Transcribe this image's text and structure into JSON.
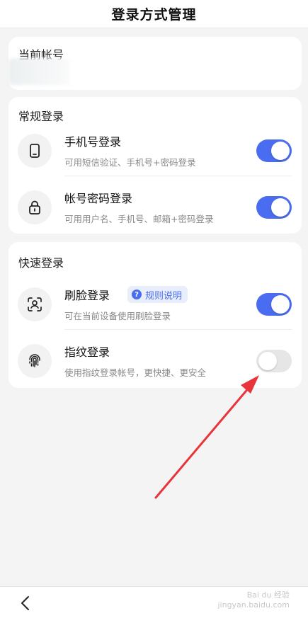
{
  "header": {
    "title": "登录方式管理"
  },
  "account_card": {
    "title": "当前帐号"
  },
  "regular_login": {
    "title": "常规登录",
    "items": [
      {
        "label": "手机号登录",
        "sub": "可用短信验证、手机号+密码登录",
        "icon": "phone-icon",
        "enabled": true
      },
      {
        "label": "帐号密码登录",
        "sub": "可用用户名、手机号、邮箱+密码登录",
        "icon": "lock-icon",
        "enabled": true
      }
    ]
  },
  "quick_login": {
    "title": "快速登录",
    "items": [
      {
        "label": "刷脸登录",
        "sub": "可在当前设备使用刷脸登录",
        "icon": "face-scan-icon",
        "enabled": true,
        "badge": "规则说明"
      },
      {
        "label": "指纹登录",
        "sub": "使用指纹登录帐号，更快捷、更安全",
        "icon": "fingerprint-icon",
        "enabled": false
      }
    ]
  },
  "bottom_bar": {
    "back_icon": "chevron-left-icon"
  },
  "watermark": {
    "line1": "Bai du 经验",
    "line2": "jingyan.baidu.com"
  },
  "colors": {
    "accent": "#4a6cf0",
    "toggle_off": "#e6e6e6",
    "background": "#f4f4f4",
    "arrow": "#e8343b"
  }
}
